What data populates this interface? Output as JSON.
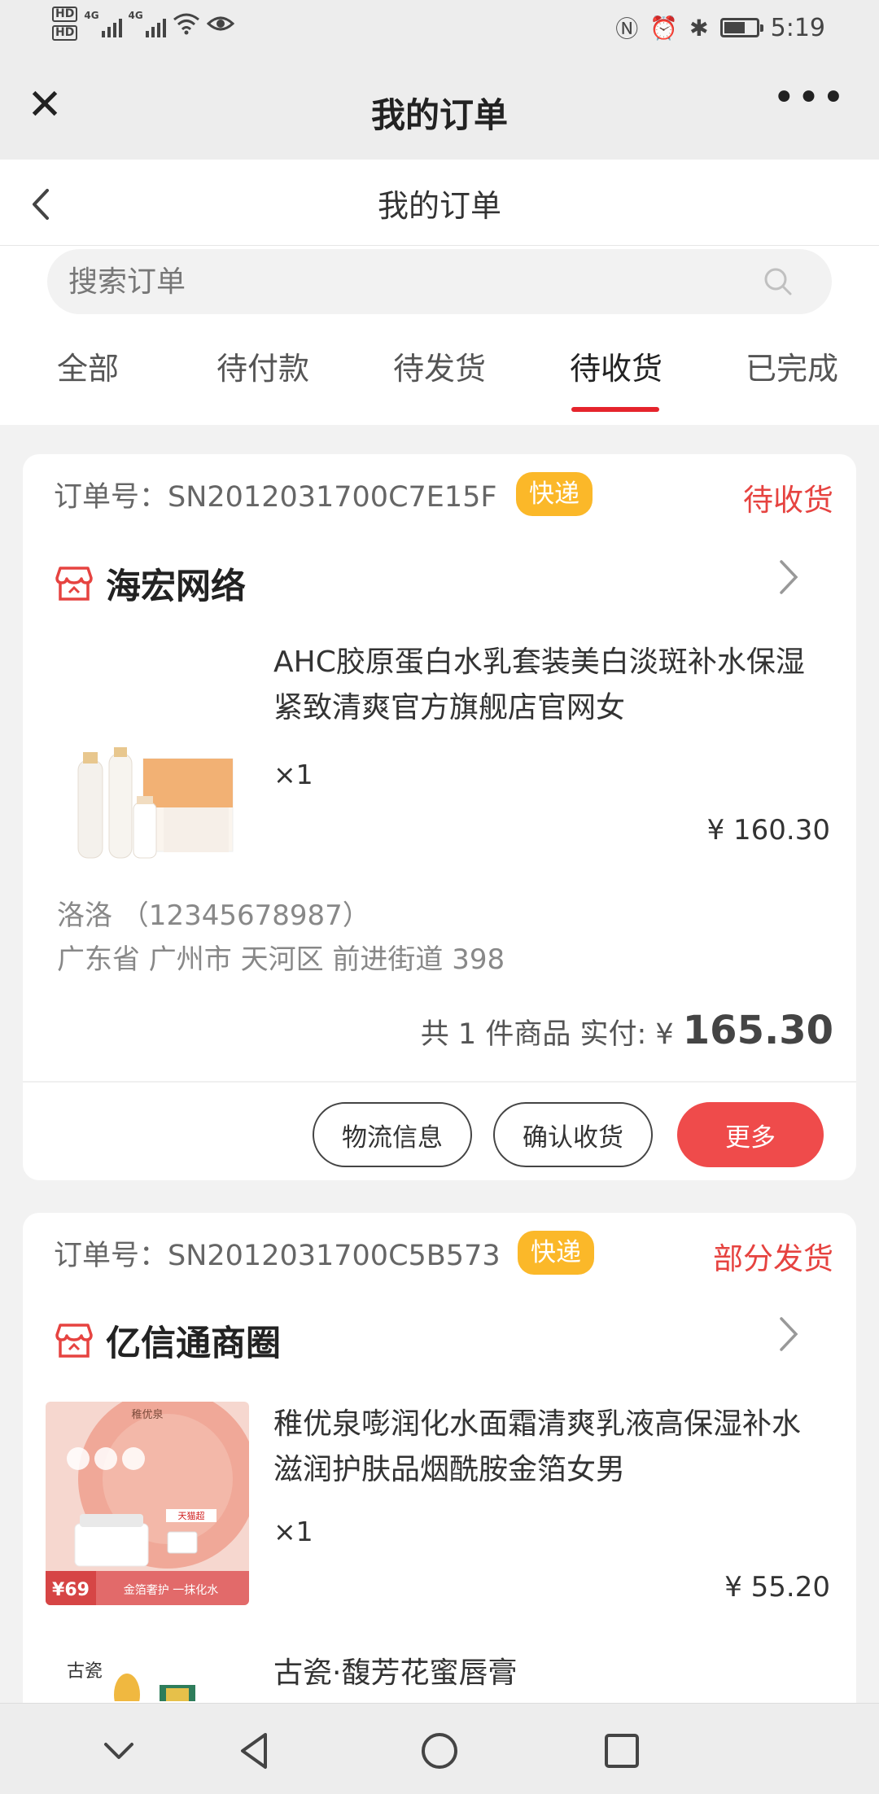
{
  "status_bar": {
    "hd1": "HD",
    "hd2": "HD",
    "net1": "4G",
    "net2": "4G",
    "time": "5:19"
  },
  "title_bar": {
    "title": "我的订单"
  },
  "page_header": {
    "title": "我的订单"
  },
  "search": {
    "placeholder": "搜索订单"
  },
  "tabs": [
    {
      "label": "全部"
    },
    {
      "label": "待付款"
    },
    {
      "label": "待发货"
    },
    {
      "label": "待收货"
    },
    {
      "label": "已完成"
    }
  ],
  "active_tab": "待收货",
  "orders": [
    {
      "order_label": "订单号：SN2012031700C7E15F",
      "badge": "快递",
      "status": "待收货",
      "shop": "海宏网络",
      "product": {
        "name": "AHC胶原蛋白水乳套装美白淡斑补水保湿紧致清爽官方旗舰店官网女",
        "qty": "×1",
        "price": "¥ 160.30"
      },
      "receiver": "洛洛 （12345678987）",
      "address": "广东省 广州市 天河区 前进街道 398",
      "total_label": "共 1 件商品 实付: ¥ ",
      "total_amount": "165.30",
      "buttons": {
        "logistics": "物流信息",
        "confirm": "确认收货",
        "more": "更多"
      }
    },
    {
      "order_label": "订单号：SN2012031700C5B573",
      "badge": "快递",
      "status": "部分发货",
      "shop": "亿信通商圈",
      "products": [
        {
          "name": "稚优泉嘭润化水面霜清爽乳液高保湿补水滋润护肤品烟酰胺金箔女男",
          "qty": "×1",
          "price": "¥ 55.20",
          "thumb_text": {
            "brand": "稚优泉",
            "tag": "天猫超",
            "price_small": "¥69",
            "slogan": "金箔奢护 一抹化水"
          }
        },
        {
          "name": "古瓷·馥芳花蜜唇膏",
          "thumb_text": {
            "brand": "古瓷"
          }
        }
      ]
    }
  ],
  "colors": {
    "accent_red": "#e5242c",
    "status_red": "#e64340",
    "badge_yellow": "#fbb829",
    "button_red": "#ef4b4b"
  }
}
